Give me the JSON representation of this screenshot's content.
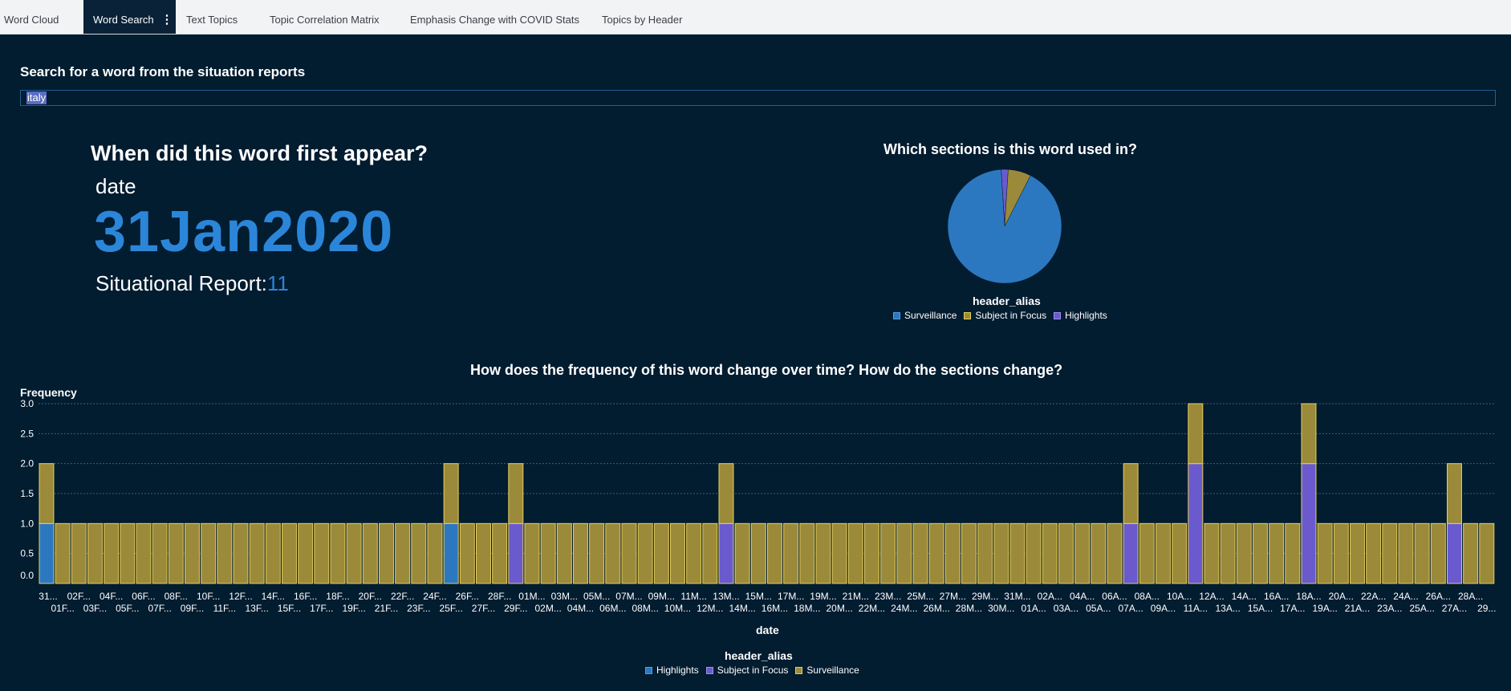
{
  "tabs": [
    {
      "label": "Word Cloud",
      "active": false
    },
    {
      "label": "Word Search",
      "active": true
    },
    {
      "label": "Text Topics",
      "active": false
    },
    {
      "label": "Topic Correlation Matrix",
      "active": false
    },
    {
      "label": "Emphasis Change with COVID Stats",
      "active": false
    },
    {
      "label": "Topics by Header",
      "active": false
    }
  ],
  "tab_menu_icon": "⋮",
  "search": {
    "heading": "Search for a word from the situation reports",
    "value": "italy"
  },
  "first_appearance": {
    "title": "When did this word first appear?",
    "date_label": "date",
    "date_value": "31Jan2020",
    "sitrep_label": "Situational Report:",
    "sitrep_value": "11"
  },
  "colors": {
    "background": "#021c30",
    "accent": "#2b86d9",
    "surveillance": "#9c8a3b",
    "subject_in_focus": "#6a5acd",
    "highlights": "#2c78c0",
    "bar_outline": "#e6cf5d"
  },
  "pie_chart": {
    "title": "Which sections is this word used in?",
    "legend_title": "header_alias",
    "legend": [
      "Surveillance",
      "Subject in Focus",
      "Highlights"
    ]
  },
  "bar_chart": {
    "title": "How does the frequency of this word change over time? How do the sections change?",
    "ylabel": "Frequency",
    "xlabel": "date",
    "legend_title": "header_alias",
    "legend": [
      "Highlights",
      "Subject in Focus",
      "Surveillance"
    ]
  },
  "chart_data": [
    {
      "type": "pie",
      "title": "Which sections is this word used in?",
      "legend_title": "header_alias",
      "labels": [
        "Surveillance",
        "Subject in Focus",
        "Highlights"
      ],
      "values": [
        91.5,
        6.5,
        2.0
      ],
      "colors": [
        "#2c78c0",
        "#9c8a3b",
        "#6a5acd"
      ]
    },
    {
      "type": "bar",
      "stacked": true,
      "title": "How does the frequency of this word change over time? How do the sections change?",
      "xlabel": "date",
      "ylabel": "Frequency",
      "ylim": [
        0,
        3
      ],
      "yticks": [
        "0.0",
        "0.5",
        "1.0",
        "1.5",
        "2.0",
        "2.5",
        "3.0"
      ],
      "grid": true,
      "legend_title": "header_alias",
      "legend_position": "bottom",
      "categories": [
        "31...",
        "01F...",
        "02F...",
        "03F...",
        "04F...",
        "05F...",
        "06F...",
        "07F...",
        "08F...",
        "09F...",
        "10F...",
        "11F...",
        "12F...",
        "13F...",
        "14F...",
        "15F...",
        "16F...",
        "17F...",
        "18F...",
        "19F...",
        "20F...",
        "21F...",
        "22F...",
        "23F...",
        "24F...",
        "25F...",
        "26F...",
        "27F...",
        "28F...",
        "29F...",
        "01M...",
        "02M...",
        "03M...",
        "04M...",
        "05M...",
        "06M...",
        "07M...",
        "08M...",
        "09M...",
        "10M...",
        "11M...",
        "12M...",
        "13M...",
        "14M...",
        "15M...",
        "16M...",
        "17M...",
        "18M...",
        "19M...",
        "20M...",
        "21M...",
        "22M...",
        "23M...",
        "24M...",
        "25M...",
        "26M...",
        "27M...",
        "28M...",
        "29M...",
        "30M...",
        "31M...",
        "01A...",
        "02A...",
        "03A...",
        "04A...",
        "05A...",
        "06A...",
        "07A...",
        "08A...",
        "09A...",
        "10A...",
        "11A...",
        "12A...",
        "13A...",
        "14A...",
        "15A...",
        "16A...",
        "17A...",
        "18A...",
        "19A...",
        "20A...",
        "21A...",
        "22A...",
        "23A...",
        "24A...",
        "25A...",
        "26A...",
        "27A...",
        "28A...",
        "29..."
      ],
      "series": [
        {
          "name": "Highlights",
          "color": "#2c78c0",
          "values": [
            1,
            0,
            0,
            0,
            0,
            0,
            0,
            0,
            0,
            0,
            0,
            0,
            0,
            0,
            0,
            0,
            0,
            0,
            0,
            0,
            0,
            0,
            0,
            0,
            0,
            1,
            0,
            0,
            0,
            0,
            0,
            0,
            0,
            0,
            0,
            0,
            0,
            0,
            0,
            0,
            0,
            0,
            0,
            0,
            0,
            0,
            0,
            0,
            0,
            0,
            0,
            0,
            0,
            0,
            0,
            0,
            0,
            0,
            0,
            0,
            0,
            0,
            0,
            0,
            0,
            0,
            0,
            0,
            0,
            0,
            0,
            0,
            0,
            0,
            0,
            0,
            0,
            0,
            0,
            0,
            0,
            0,
            0,
            0,
            0,
            0,
            0,
            0,
            0,
            0
          ]
        },
        {
          "name": "Subject in Focus",
          "color": "#6a5acd",
          "values": [
            0,
            0,
            0,
            0,
            0,
            0,
            0,
            0,
            0,
            0,
            0,
            0,
            0,
            0,
            0,
            0,
            0,
            0,
            0,
            0,
            0,
            0,
            0,
            0,
            0,
            0,
            0,
            0,
            0,
            1,
            0,
            0,
            0,
            0,
            0,
            0,
            0,
            0,
            0,
            0,
            0,
            0,
            1,
            0,
            0,
            0,
            0,
            0,
            0,
            0,
            0,
            0,
            0,
            0,
            0,
            0,
            0,
            0,
            0,
            0,
            0,
            0,
            0,
            0,
            0,
            0,
            0,
            1,
            0,
            0,
            0,
            2,
            0,
            0,
            0,
            0,
            0,
            0,
            2,
            0,
            0,
            0,
            0,
            0,
            0,
            0,
            0,
            1,
            0,
            0
          ]
        },
        {
          "name": "Surveillance",
          "color": "#9c8a3b",
          "values": [
            1,
            1,
            1,
            1,
            1,
            1,
            1,
            1,
            1,
            1,
            1,
            1,
            1,
            1,
            1,
            1,
            1,
            1,
            1,
            1,
            1,
            1,
            1,
            1,
            1,
            1,
            1,
            1,
            1,
            1,
            1,
            1,
            1,
            1,
            1,
            1,
            1,
            1,
            1,
            1,
            1,
            1,
            1,
            1,
            1,
            1,
            1,
            1,
            1,
            1,
            1,
            1,
            1,
            1,
            1,
            1,
            1,
            1,
            1,
            1,
            1,
            1,
            1,
            1,
            1,
            1,
            1,
            1,
            1,
            1,
            1,
            1,
            1,
            1,
            1,
            1,
            1,
            1,
            1,
            1,
            1,
            1,
            1,
            1,
            1,
            1,
            1,
            1,
            1,
            1
          ]
        }
      ]
    }
  ]
}
